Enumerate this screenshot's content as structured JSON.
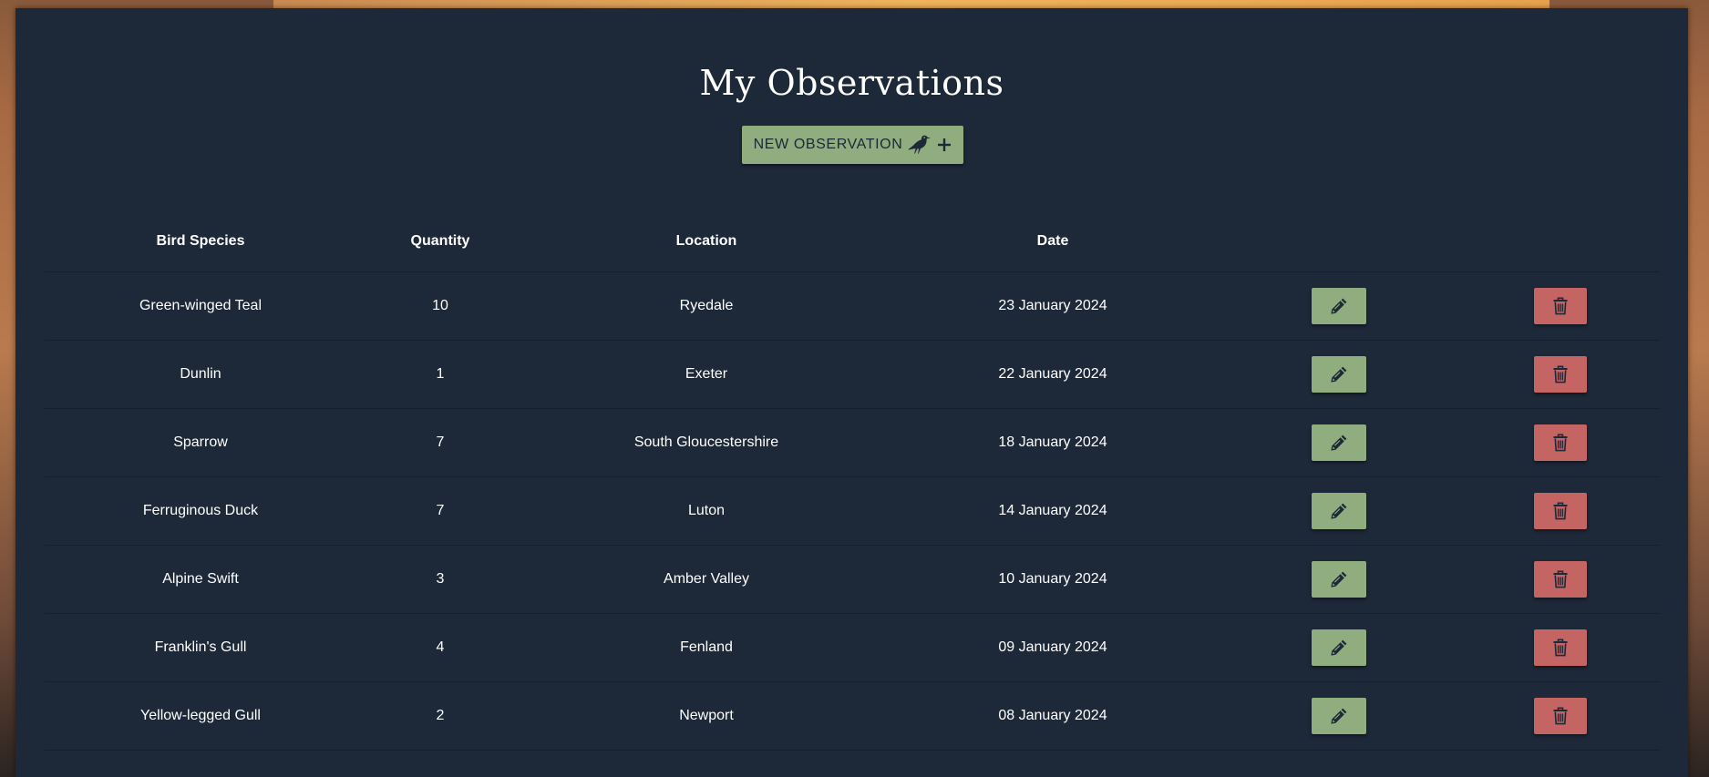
{
  "page": {
    "title": "My Observations",
    "new_button_label": "NEW OBSERVATION"
  },
  "table": {
    "headers": {
      "species": "Bird Species",
      "quantity": "Quantity",
      "location": "Location",
      "date": "Date"
    },
    "rows": [
      {
        "species": "Green-winged Teal",
        "quantity": "10",
        "location": "Ryedale",
        "date": "23 January 2024"
      },
      {
        "species": "Dunlin",
        "quantity": "1",
        "location": "Exeter",
        "date": "22 January 2024"
      },
      {
        "species": "Sparrow",
        "quantity": "7",
        "location": "South Gloucestershire",
        "date": "18 January 2024"
      },
      {
        "species": "Ferruginous Duck",
        "quantity": "7",
        "location": "Luton",
        "date": "14 January 2024"
      },
      {
        "species": "Alpine Swift",
        "quantity": "3",
        "location": "Amber Valley",
        "date": "10 January 2024"
      },
      {
        "species": "Franklin's Gull",
        "quantity": "4",
        "location": "Fenland",
        "date": "09 January 2024"
      },
      {
        "species": "Yellow-legged Gull",
        "quantity": "2",
        "location": "Newport",
        "date": "08 January 2024"
      }
    ]
  },
  "icons": {
    "new_button": [
      "crow-icon",
      "plus-icon"
    ],
    "edit": "pencil-icon",
    "delete": "trash-icon"
  },
  "colors": {
    "panel": "#1d2838",
    "edit_button": "#8fad7e",
    "delete_button": "#c46564",
    "text": "#ffffff"
  }
}
